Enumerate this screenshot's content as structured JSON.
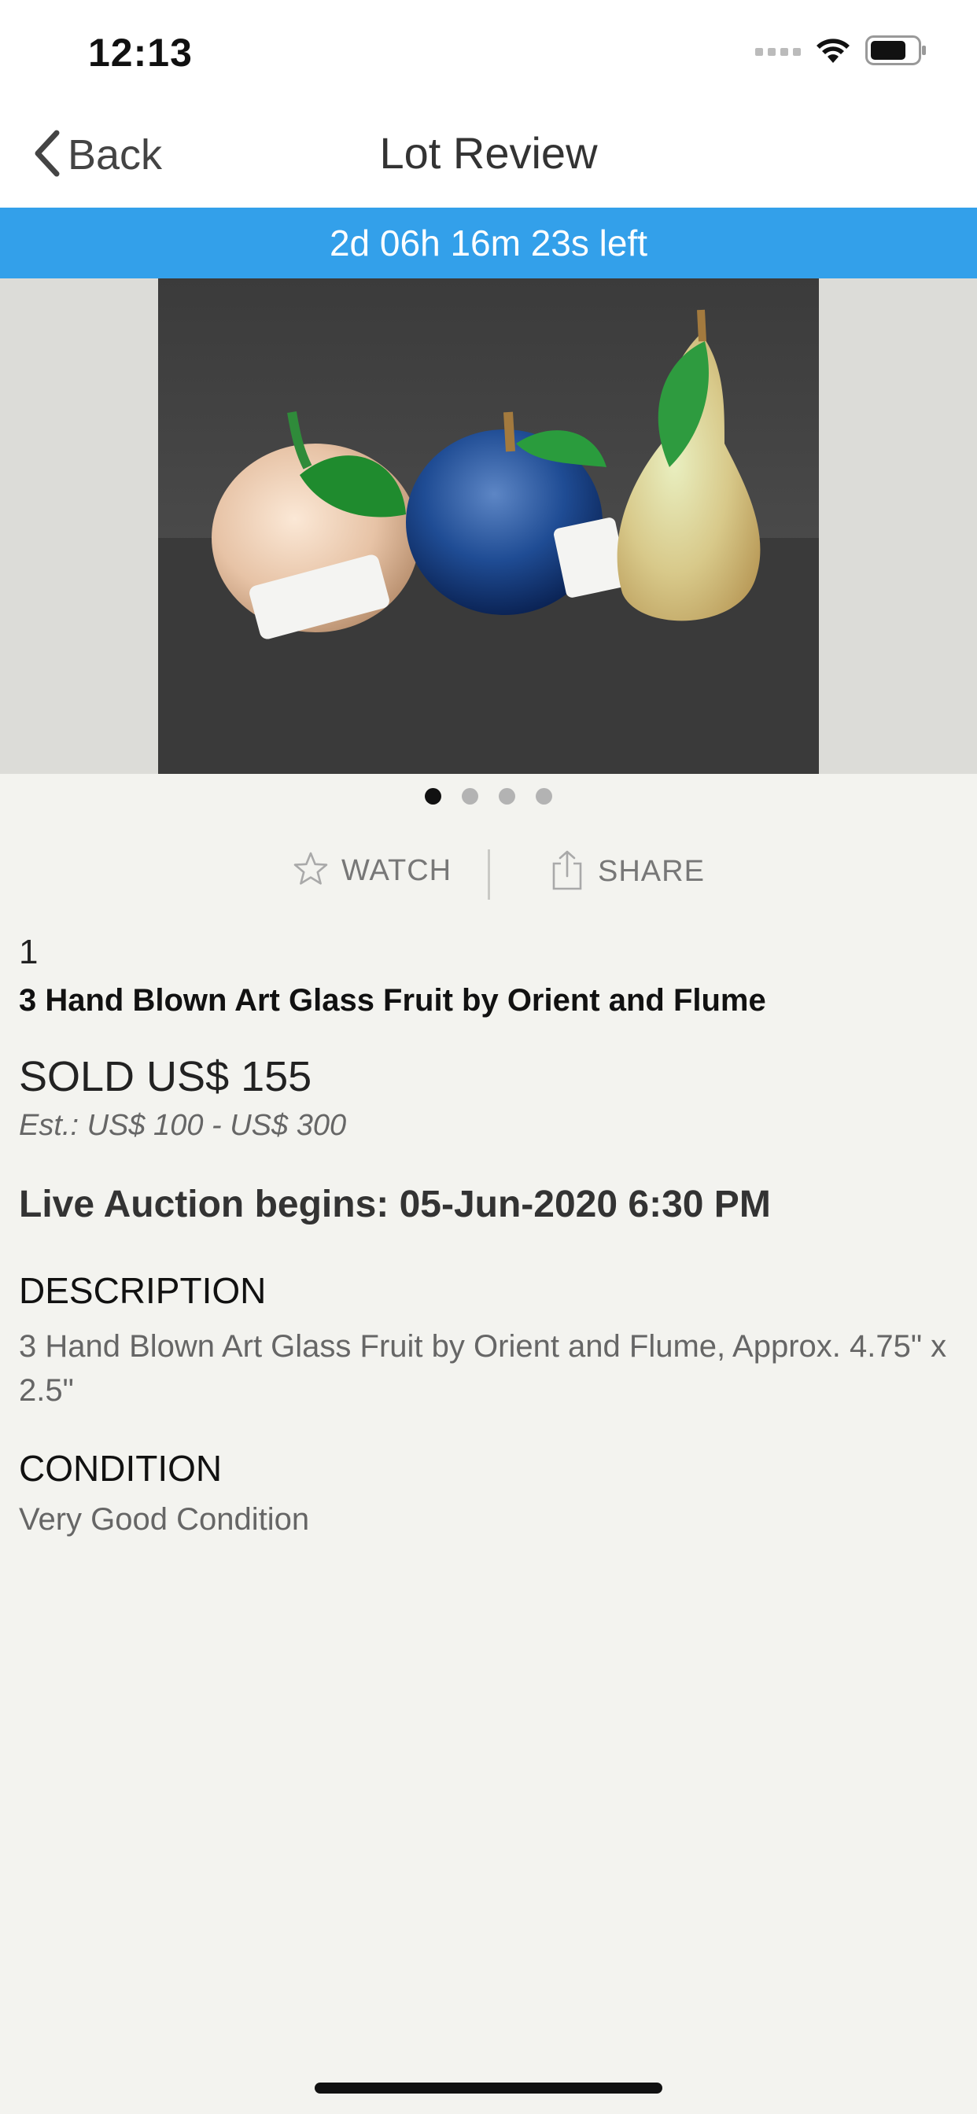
{
  "status_bar": {
    "time": "12:13",
    "icons": [
      "cellular-icon",
      "wifi-icon",
      "battery-icon"
    ]
  },
  "nav": {
    "back_label": "Back",
    "title": "Lot Review"
  },
  "timer": {
    "text": "2d 06h 16m 23s left",
    "color": "#33a0ea"
  },
  "gallery": {
    "image_count": 4,
    "active_index": 0
  },
  "actions": {
    "watch_label": "WATCH",
    "share_label": "SHARE"
  },
  "lot": {
    "number": "1",
    "title": "3 Hand Blown Art Glass Fruit by Orient and Flume",
    "sold": "SOLD US$ 155",
    "estimate": "Est.: US$ 100 - US$ 300",
    "live_auction": "Live Auction begins: 05-Jun-2020 6:30 PM"
  },
  "description": {
    "heading": "DESCRIPTION",
    "text": "3 Hand Blown Art Glass Fruit by Orient and Flume, Approx. 4.75\" x 2.5\""
  },
  "condition": {
    "heading": "CONDITION",
    "text": "Very Good Condition"
  }
}
